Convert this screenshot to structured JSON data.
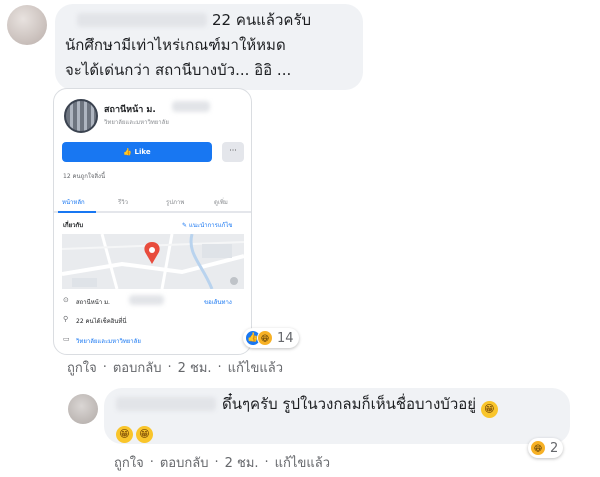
{
  "comment": {
    "line1_suffix": "22 คนแล้วครับ",
    "line2": "นักศึกษามีเท่าไหร่เกณฑ์มาให้หมด",
    "line3": "จะได้เด่นกว่า สถานีบางบัว... อิอิ ...",
    "reaction_count": "14",
    "actions": {
      "like": "ถูกใจ",
      "reply": "ตอบกลับ",
      "time": "2 ชม.",
      "edited": "แก้ไขแล้ว",
      "sep": "·"
    }
  },
  "attachment": {
    "page_name": "สถานีหน้า ม.",
    "page_category": "วิทยาลัยและมหาวิทยาลัย",
    "like_button": "Like",
    "more_button": "···",
    "likes_text": "12 คนถูกใจสิ่งนี้",
    "tabs": [
      "หน้าหลัก",
      "รีวิว",
      "รูปภาพ",
      "ดูเพิ่ม"
    ],
    "section_title": "เกี่ยวกับ",
    "suggest_edit": "แนะนำการแก้ไข",
    "address": "สถานีหน้า ม.",
    "directions": "ขอเส้นทาง",
    "checkins": "22 คนได้เช็คอินที่นี่",
    "category_link": "วิทยาลัยและมหาวิทยาลัย"
  },
  "reply": {
    "text1": "ดึ๋นๆครับ รูปในวงกลมก็เห็นชื่อบางบัวอยู่",
    "reaction_count": "2",
    "actions": {
      "like": "ถูกใจ",
      "reply": "ตอบกลับ",
      "time": "2 ชม.",
      "edited": "แก้ไขแล้ว",
      "sep": "·"
    }
  },
  "colors": {
    "accent": "#1877f2",
    "bubble": "#f0f2f5",
    "muted": "#65676b"
  }
}
